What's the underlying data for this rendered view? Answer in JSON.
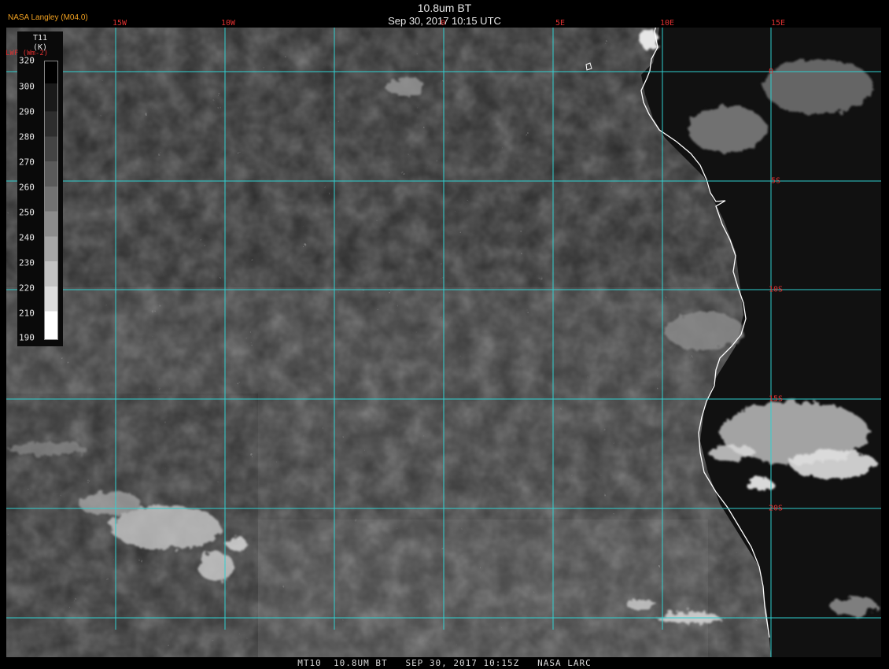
{
  "header": {
    "title": "10.8um BT",
    "subtitle": "Sep 30, 2017 10:15 UTC",
    "credit": "NASA Langley (M04.0)"
  },
  "footer": {
    "text": "MT10  10.8UM BT   SEP 30, 2017 10:15Z   NASA LARC"
  },
  "legend": {
    "variable": "T11",
    "unit": "(K)",
    "alt_label": "LWF (Wm-2)",
    "ticks": [
      "320",
      "300",
      "290",
      "280",
      "270",
      "260",
      "250",
      "240",
      "230",
      "220",
      "210",
      "190"
    ]
  },
  "grid": {
    "lon_labels": [
      "15W",
      "10W",
      "0",
      "5E",
      "10E",
      "15E"
    ],
    "lat_labels": [
      "0",
      "5S",
      "10S",
      "15S",
      "20S"
    ],
    "line_color": "#30d0d0"
  },
  "colors": {
    "label_red": "#e03030",
    "coastline": "#ffffff",
    "credit": "#f0a020"
  }
}
